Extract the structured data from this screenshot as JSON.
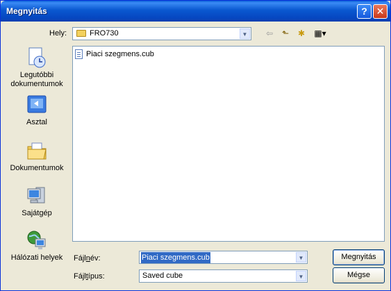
{
  "window": {
    "title": "Megnyitás",
    "help_glyph": "?",
    "close_glyph": "✕"
  },
  "toolbar": {
    "location_label": "Hely:",
    "location_value": "FRO730",
    "back_glyph": "⇦",
    "up_glyph": "⬑",
    "newfolder_glyph": "✱",
    "views_glyph": "▦▾"
  },
  "places": [
    {
      "label_line1": "Legutóbbi",
      "label_line2": "dokumentumok",
      "icon": "recent-documents-icon"
    },
    {
      "label_line1": "Asztal",
      "label_line2": "",
      "icon": "desktop-icon"
    },
    {
      "label_line1": "Dokumentumok",
      "label_line2": "",
      "icon": "my-documents-icon"
    },
    {
      "label_line1": "Sajátgép",
      "label_line2": "",
      "icon": "my-computer-icon"
    },
    {
      "label_line1": "Hálózati helyek",
      "label_line2": "",
      "icon": "network-places-icon"
    }
  ],
  "files": [
    {
      "name": "Piaci szegmens.cub"
    }
  ],
  "filename": {
    "label": "Fájlnév:",
    "value": "Piaci szegmens.cub"
  },
  "filetype": {
    "label": "Fájltípus:",
    "value": "Saved cube"
  },
  "buttons": {
    "open": "Megnyitás",
    "cancel": "Mégse"
  }
}
